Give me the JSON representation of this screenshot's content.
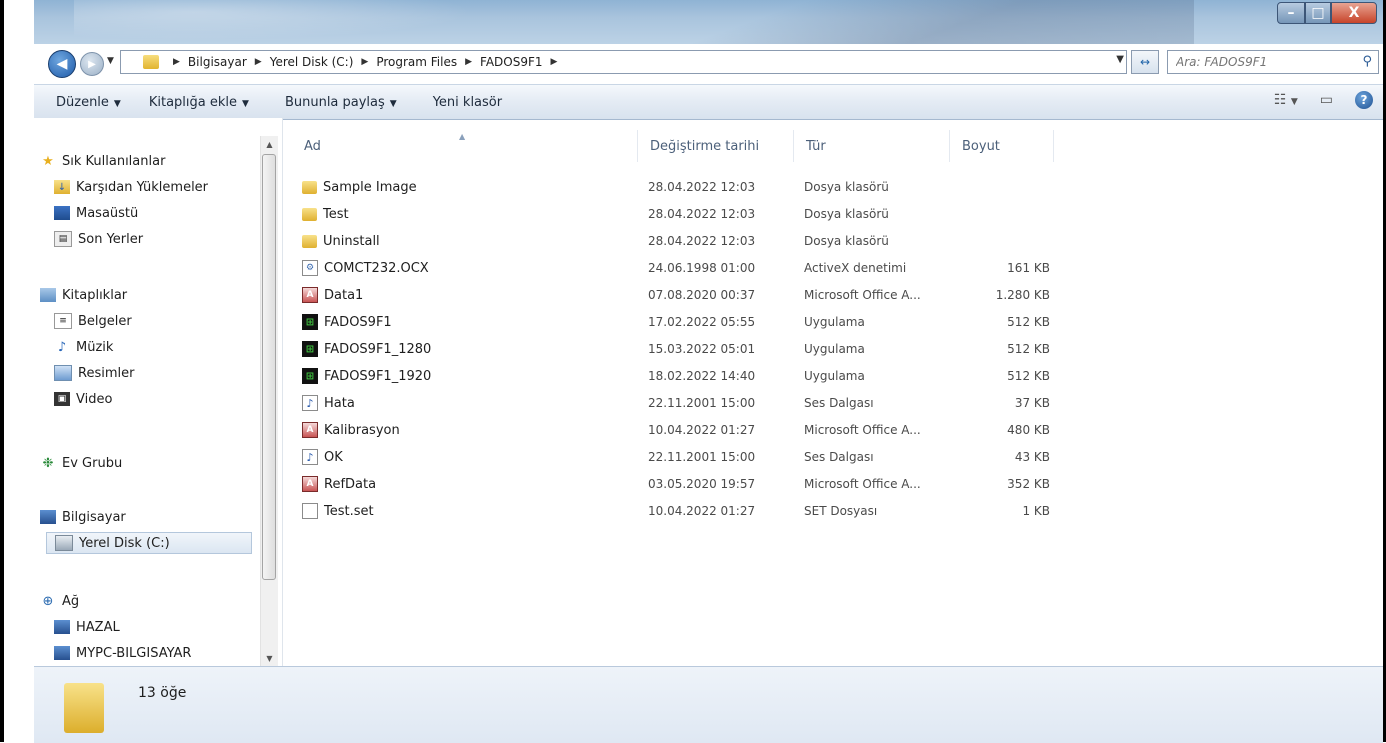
{
  "window": {
    "buttons": {
      "minimize": "–",
      "maximize": "□",
      "close": "X"
    }
  },
  "address": {
    "crumbs": [
      "Bilgisayar",
      "Yerel Disk (C:)",
      "Program Files",
      "FADOS9F1"
    ],
    "search_placeholder": "Ara: FADOS9F1"
  },
  "toolbar": {
    "organize": "Düzenle",
    "include_library": "Kitaplığa ekle",
    "share_with": "Bununla paylaş",
    "new_folder": "Yeni klasör"
  },
  "nav": {
    "favorites": "Sık Kullanılanlar",
    "downloads": "Karşıdan Yüklemeler",
    "desktop": "Masaüstü",
    "recent": "Son Yerler",
    "libraries": "Kitaplıklar",
    "documents": "Belgeler",
    "music": "Müzik",
    "pictures": "Resimler",
    "video": "Video",
    "homegroup": "Ev Grubu",
    "computer": "Bilgisayar",
    "local_disk": "Yerel Disk (C:)",
    "network": "Ağ",
    "hazal": "HAZAL",
    "mypc": "MYPC-BILGISAYAR"
  },
  "columns": {
    "name": "Ad",
    "date": "Değiştirme tarihi",
    "type": "Tür",
    "size": "Boyut"
  },
  "files": [
    {
      "name": "Sample Image",
      "date": "28.04.2022 12:03",
      "type": "Dosya klasörü",
      "size": ""
    },
    {
      "name": "Test",
      "date": "28.04.2022 12:03",
      "type": "Dosya klasörü",
      "size": ""
    },
    {
      "name": "Uninstall",
      "date": "28.04.2022 12:03",
      "type": "Dosya klasörü",
      "size": ""
    },
    {
      "name": "COMCT232.OCX",
      "date": "24.06.1998 01:00",
      "type": "ActiveX denetimi",
      "size": "161 KB"
    },
    {
      "name": "Data1",
      "date": "07.08.2020 00:37",
      "type": "Microsoft Office A...",
      "size": "1.280 KB"
    },
    {
      "name": "FADOS9F1",
      "date": "17.02.2022 05:55",
      "type": "Uygulama",
      "size": "512 KB"
    },
    {
      "name": "FADOS9F1_1280",
      "date": "15.03.2022 05:01",
      "type": "Uygulama",
      "size": "512 KB"
    },
    {
      "name": "FADOS9F1_1920",
      "date": "18.02.2022 14:40",
      "type": "Uygulama",
      "size": "512 KB"
    },
    {
      "name": "Hata",
      "date": "22.11.2001 15:00",
      "type": "Ses Dalgası",
      "size": "37 KB"
    },
    {
      "name": "Kalibrasyon",
      "date": "10.04.2022 01:27",
      "type": "Microsoft Office A...",
      "size": "480 KB"
    },
    {
      "name": "OK",
      "date": "22.11.2001 15:00",
      "type": "Ses Dalgası",
      "size": "43 KB"
    },
    {
      "name": "RefData",
      "date": "03.05.2020 19:57",
      "type": "Microsoft Office A...",
      "size": "352 KB"
    },
    {
      "name": "Test.set",
      "date": "10.04.2022 01:27",
      "type": "SET Dosyası",
      "size": "1 KB"
    }
  ],
  "status": {
    "count": "13 öğe"
  }
}
